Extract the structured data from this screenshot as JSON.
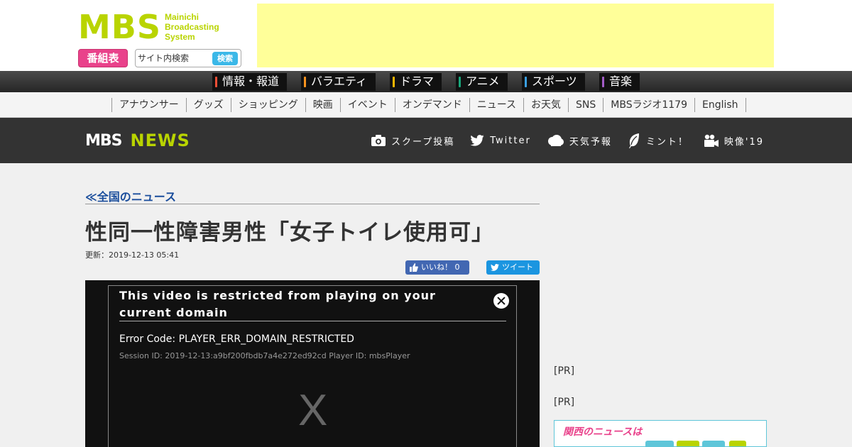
{
  "header": {
    "logo_mark": [
      "M",
      "B",
      "S"
    ],
    "logo_text": [
      "Mainichi",
      "Broadcasting",
      "System"
    ],
    "bangumi_label": "番組表",
    "search": {
      "placeholder": "サイト内検索",
      "button_label": "検索"
    }
  },
  "genre_nav": [
    {
      "label": "情報・報道",
      "color": "#f04e36"
    },
    {
      "label": "バラエティ",
      "color": "#f7931e"
    },
    {
      "label": "ドラマ",
      "color": "#f7b500"
    },
    {
      "label": "アニメ",
      "color": "#19a67a"
    },
    {
      "label": "スポーツ",
      "color": "#3b9fe0"
    },
    {
      "label": "音楽",
      "color": "#a35cc7"
    }
  ],
  "sub_nav": [
    "アナウンサー",
    "グッズ",
    "ショッピング",
    "映画",
    "イベント",
    "オンデマンド",
    "ニュース",
    "お天気",
    "SNS",
    "MBSラジオ1179",
    "English"
  ],
  "news_header": {
    "logo_mbs": "MBS",
    "logo_news": "NEWS",
    "links": [
      {
        "label": "スクープ投稿",
        "icon": "camera-icon"
      },
      {
        "label": "Twitter",
        "icon": "twitter-icon"
      },
      {
        "label": "天気予報",
        "icon": "cloud-icon"
      },
      {
        "label": "ミント！",
        "icon": "leaf-icon"
      },
      {
        "label": "映像'19",
        "icon": "video-camera-icon"
      }
    ]
  },
  "article": {
    "breadcrumb": "≪全国のニュース",
    "title": "性同一性障害男性「女子トイレ使用可」",
    "updated": "更新：2019-12-13 05:41",
    "like_label": "いいね！ 0",
    "tweet_label": "ツイート"
  },
  "player_error": {
    "title": "This video is restricted from playing on your current domain",
    "code": "Error Code: PLAYER_ERR_DOMAIN_RESTRICTED",
    "session": "Session ID: 2019-12-13:a9bf200fbdb7a4e272ed92cd Player ID: mbsPlayer",
    "placeholder_mark": "X"
  },
  "sidebar": {
    "pr1": "[PR]",
    "pr2": "[PR]",
    "kansai_banner_text": "関西のニュースは"
  },
  "colors": {
    "brand_green": "#b9d400",
    "bangumi_pink": "#e9428b",
    "search_blue": "#3bb8e8",
    "ad_yellow": "#ffff99",
    "breadcrumb_blue": "#1a4d9c",
    "facebook_blue": "#4267b2",
    "twitter_blue": "#1b95e0"
  }
}
